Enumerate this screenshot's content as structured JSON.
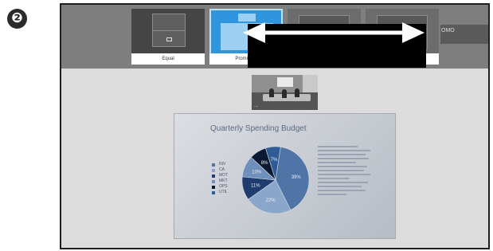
{
  "step": {
    "number": "❷"
  },
  "layout_bar": {
    "options": [
      {
        "label": "Equal",
        "state": "normal"
      },
      {
        "label": "Prominent",
        "state": "selected"
      },
      {
        "label": "",
        "state": "normal"
      },
      {
        "label": "",
        "state": "normal"
      }
    ],
    "truncated_text": "OMO"
  },
  "video_thumbnail": {
    "caption": "...."
  },
  "presentation": {
    "title": "Quarterly Spending Budget",
    "chart_data": {
      "type": "pie",
      "title": "Quarterly Spending Budget",
      "slices": [
        {
          "label": "",
          "percent": 39
        },
        {
          "label": "",
          "percent": 22
        },
        {
          "label": "",
          "percent": 11
        },
        {
          "label": "",
          "percent": 10
        },
        {
          "label": "",
          "percent": 8
        },
        {
          "label": "",
          "percent": 7
        }
      ],
      "percent_labels": [
        "39%",
        "22%",
        "11%",
        "10%",
        "8%",
        "7%"
      ],
      "legend": [
        "INV",
        "CA",
        "MOT",
        "MKT",
        "OPS",
        "UTIL"
      ]
    }
  },
  "colors": {
    "selected_option": "#2f95df",
    "slices": [
      "#4f75a6",
      "#8aa6c9",
      "#1e3c6d",
      "#6f90bd",
      "#0a1a33",
      "#2f5c96"
    ]
  },
  "icons": {
    "double_arrow": "double-headed-arrow-icon",
    "screen": "screen-icon"
  }
}
